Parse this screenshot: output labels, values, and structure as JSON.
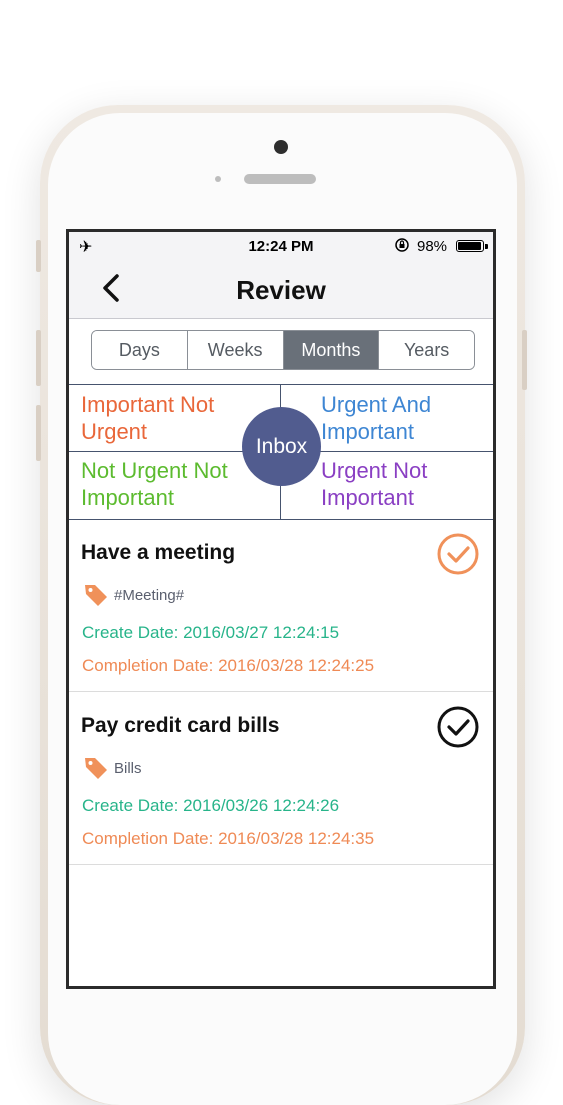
{
  "status_bar": {
    "time": "12:24 PM",
    "battery": "98%",
    "battery_level": 0.98,
    "icons": [
      "airplane-icon",
      "rotation-lock-icon",
      "battery-icon"
    ]
  },
  "nav": {
    "title": "Review",
    "back_icon": "chevron-left-icon"
  },
  "segments": {
    "items": [
      "Days",
      "Weeks",
      "Months",
      "Years"
    ],
    "selected": "Months"
  },
  "matrix": {
    "top_left": "Important Not Urgent",
    "top_right": "Urgent And Important",
    "bottom_left": "Not Urgent Not Important",
    "bottom_right": "Urgent Not Important",
    "center": "Inbox",
    "colors": {
      "top_left": "#e9673a",
      "top_right": "#3e86d3",
      "bottom_left": "#5cbb2f",
      "bottom_right": "#8a3fc3",
      "center": "#515c8f"
    }
  },
  "tasks": [
    {
      "title": "Have a meeting",
      "tag": "#Meeting#",
      "create": "Create Date: 2016/03/27 12:24:15",
      "completion": "Completion Date: 2016/03/28 12:24:25",
      "check_color": "#f0915a"
    },
    {
      "title": "Pay credit card bills",
      "tag": "Bills",
      "create": "Create Date: 2016/03/26 12:24:26",
      "completion": "Completion Date: 2016/03/28 12:24:35",
      "check_color": "#111111"
    }
  ],
  "colors": {
    "accent_create": "#27b48a",
    "accent_completion": "#ef8a55",
    "tag_icon": "#f0915a",
    "segment_active": "#697079"
  }
}
